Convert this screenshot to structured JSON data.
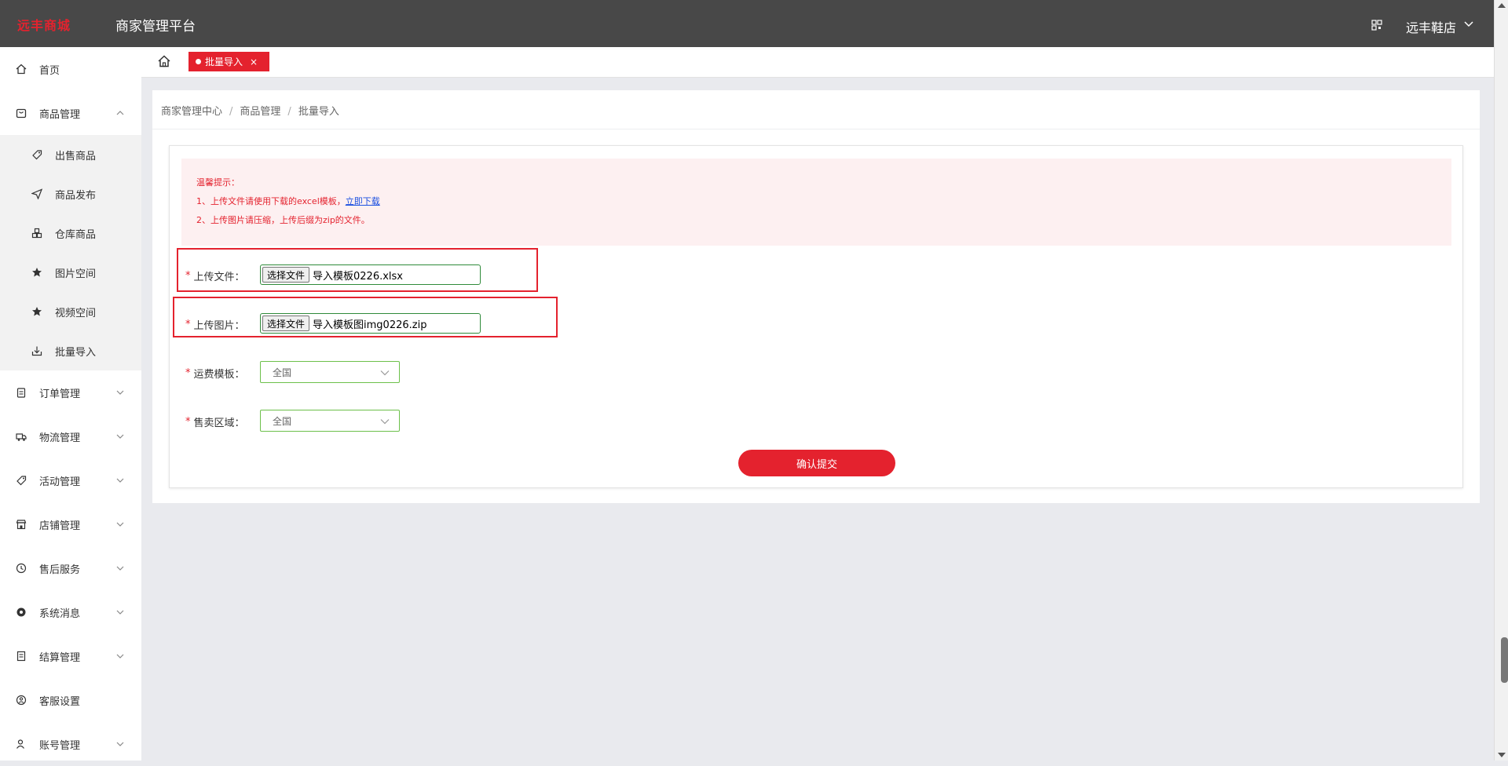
{
  "header": {
    "logo_text": "远丰商城",
    "platform_title": "商家管理平台",
    "shop_name": "远丰鞋店"
  },
  "sidebar": {
    "items": [
      {
        "label": "首页",
        "icon": "home-icon"
      },
      {
        "label": "商品管理",
        "icon": "goods-icon",
        "expanded": true
      },
      {
        "label": "订单管理",
        "icon": "order-icon"
      },
      {
        "label": "物流管理",
        "icon": "truck-icon"
      },
      {
        "label": "活动管理",
        "icon": "tag-icon"
      },
      {
        "label": "店铺管理",
        "icon": "store-icon"
      },
      {
        "label": "售后服务",
        "icon": "service-icon"
      },
      {
        "label": "系统消息",
        "icon": "message-icon"
      },
      {
        "label": "结算管理",
        "icon": "settlement-icon"
      },
      {
        "label": "客服设置",
        "icon": "support-icon"
      },
      {
        "label": "账号管理",
        "icon": "account-icon"
      }
    ],
    "goods_submenu": [
      {
        "label": "出售商品",
        "icon": "tag-icon"
      },
      {
        "label": "商品发布",
        "icon": "send-icon"
      },
      {
        "label": "仓库商品",
        "icon": "warehouse-icon"
      },
      {
        "label": "图片空间",
        "icon": "star-icon"
      },
      {
        "label": "视频空间",
        "icon": "star-icon"
      },
      {
        "label": "批量导入",
        "icon": "import-icon",
        "active": true
      }
    ]
  },
  "tabs": {
    "active_label": "批量导入",
    "close_symbol": "×"
  },
  "breadcrumb": [
    "商家管理中心",
    "商品管理",
    "批量导入"
  ],
  "tips": {
    "title": "温馨提示：",
    "line1": "1、上传文件请使用下载的excel模板，",
    "download_link": "立即下载",
    "line2": "2、上传图片请压缩，上传后缀为zip的文件。"
  },
  "form": {
    "file_label": "上传文件：",
    "file_button": "选择文件",
    "file_value": "导入模板0226.xlsx",
    "image_label": "上传图片：",
    "image_button": "选择文件",
    "image_value": "导入模板图img0226.zip",
    "freight_label": "运费模板：",
    "freight_value": "全国",
    "region_label": "售卖区域：",
    "region_value": "全国",
    "submit_label": "确认提交",
    "required_mark": "*"
  },
  "colors": {
    "accent": "#e4222e",
    "header_bg": "#484848"
  }
}
